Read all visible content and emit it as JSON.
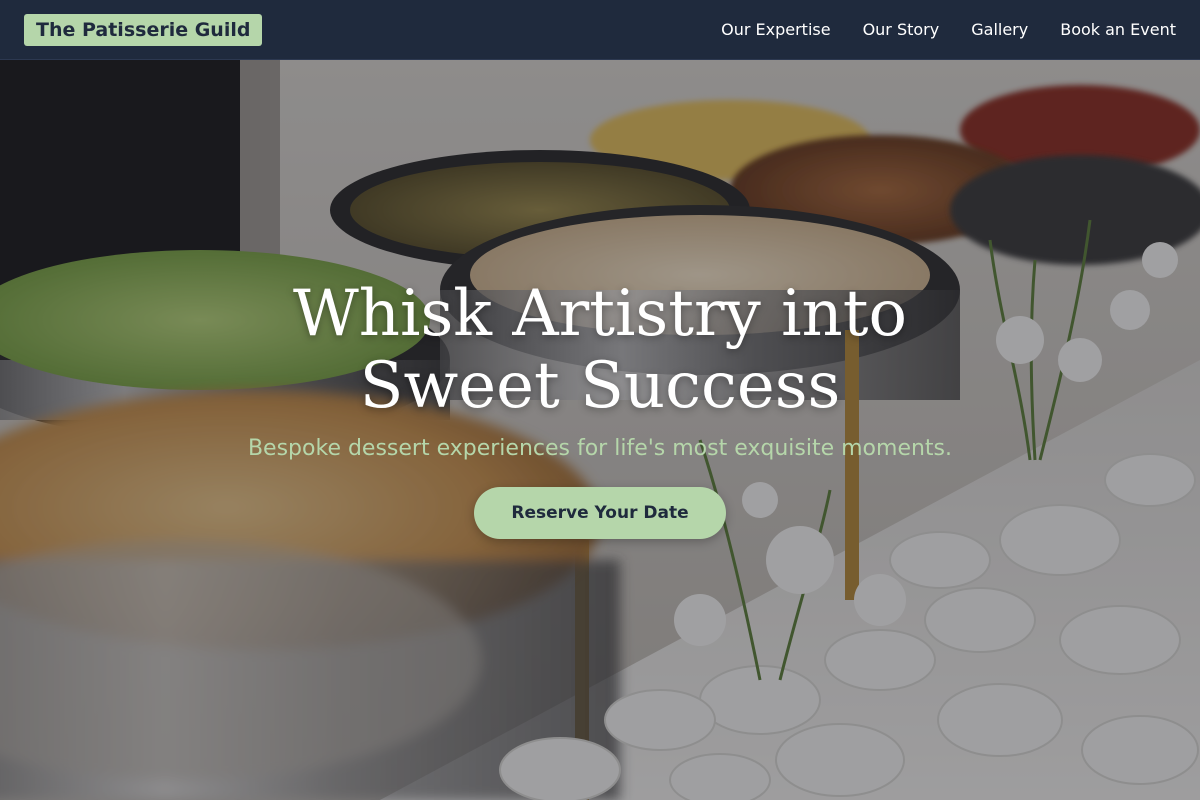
{
  "nav": {
    "brand": "The Patisserie Guild",
    "links": [
      "Our Expertise",
      "Our Story",
      "Gallery",
      "Book an Event"
    ]
  },
  "hero": {
    "title": "Whisk Artistry into Sweet Success",
    "subtitle": "Bespoke dessert experiences for life's most exquisite moments.",
    "cta_label": "Reserve Your Date",
    "background_image": "catering buffet with chafing dishes of food, white stones and white flowers"
  },
  "colors": {
    "navbar_bg": "#1f2a3d",
    "accent": "#b5d6aa",
    "text_light": "#ffffff"
  }
}
